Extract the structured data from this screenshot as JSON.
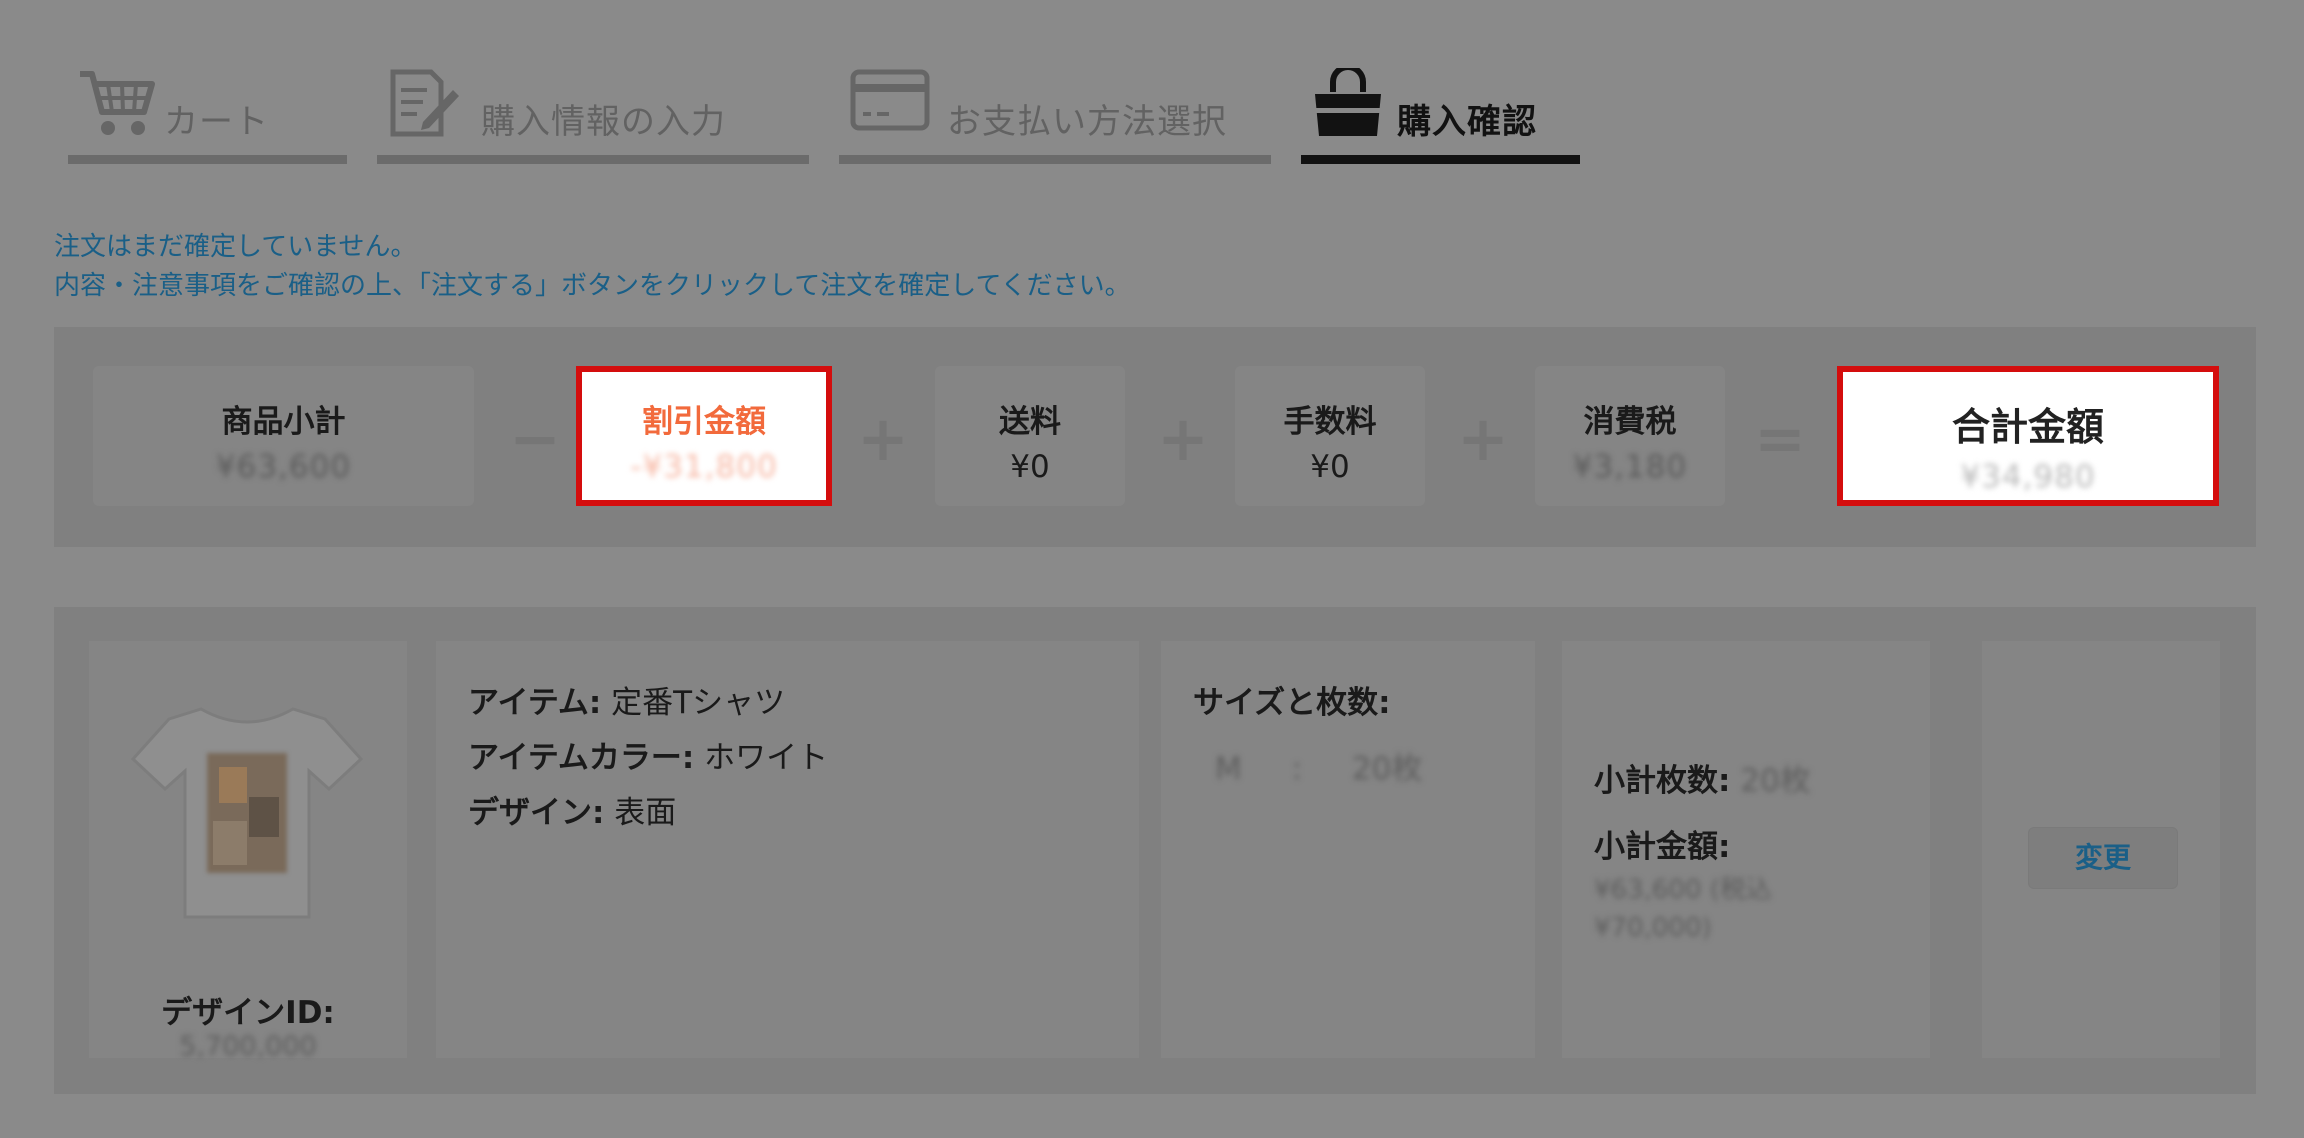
{
  "steps": [
    {
      "label": "カート",
      "icon": "cart-icon",
      "active": false
    },
    {
      "label": "購入情報の入力",
      "icon": "edit-document-icon",
      "active": false
    },
    {
      "label": "お支払い方法選択",
      "icon": "credit-card-icon",
      "active": false
    },
    {
      "label": "購入確認",
      "icon": "shopping-bag-icon",
      "active": true
    }
  ],
  "notice": {
    "line1": "注文はまだ確定していません。",
    "line2": "内容・注意事項をご確認の上、「注文する」ボタンをクリックして注文を確定してください。"
  },
  "summary": {
    "subtotal": {
      "label": "商品小計",
      "value": "¥63,600"
    },
    "discount": {
      "label": "割引金額",
      "value": "-¥31,800"
    },
    "shipping": {
      "label": "送料",
      "value": "¥0"
    },
    "fee": {
      "label": "手数料",
      "value": "¥0"
    },
    "tax": {
      "label": "消費税",
      "value": "¥3,180"
    },
    "total": {
      "label": "合計金額",
      "value": "¥34,980"
    },
    "operators": {
      "minus": "−",
      "plus": "+",
      "equals": "="
    }
  },
  "order": {
    "design_id_label": "デザインID:",
    "design_id_value": "5,700,000",
    "item_label": "アイテム:",
    "item_value": "定番Tシャツ",
    "color_label": "アイテムカラー:",
    "color_value": "ホワイト",
    "design_label": "デザイン:",
    "design_value": "表面",
    "size_qty_label": "サイズと枚数:",
    "size_value": "M",
    "size_sep": ":",
    "qty_value": "20枚",
    "subtotal_qty_label": "小計枚数:",
    "subtotal_qty_value": "20枚",
    "subtotal_amount_label": "小計金額:",
    "subtotal_amount_value": "¥63,600 (税込",
    "subtotal_amount_value2": "¥70,000)",
    "change_button": "変更"
  },
  "colors": {
    "overlay_bg": "#8a8a8a",
    "highlight_border": "#d40d0d",
    "discount_text": "#f26a3c",
    "link_blue": "#1a5f87",
    "active_step": "#121212"
  }
}
